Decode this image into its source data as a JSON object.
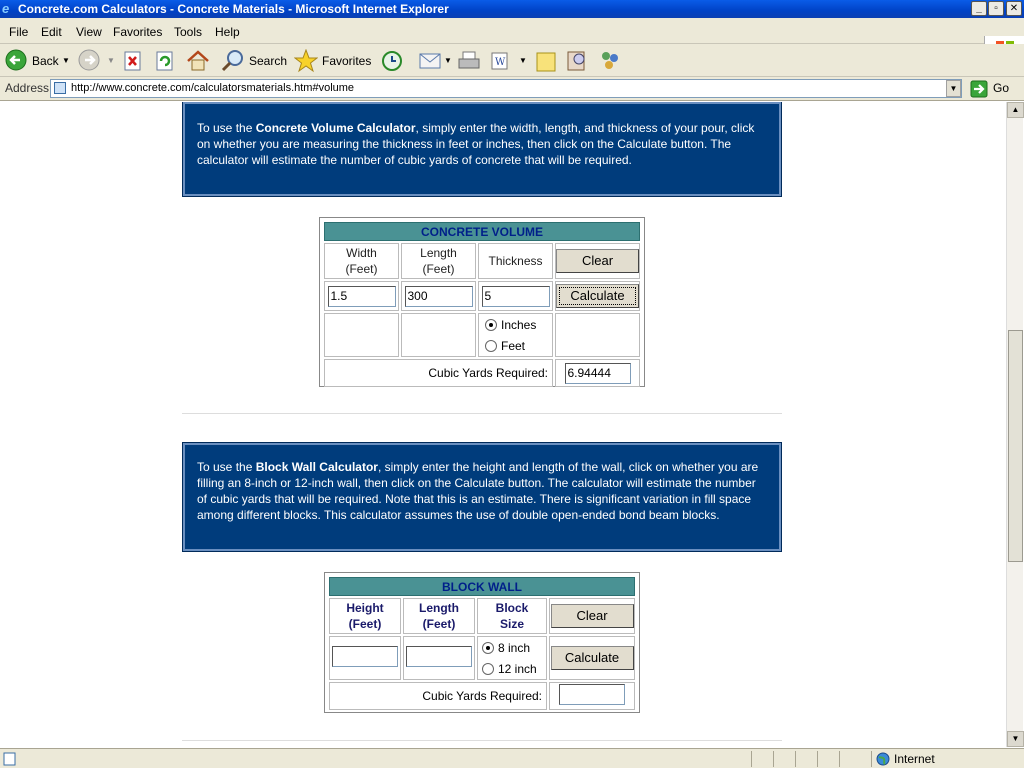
{
  "window": {
    "title": "Concrete.com Calculators - Concrete Materials - Microsoft Internet Explorer",
    "minimize": "_",
    "restore": "▫",
    "close": "✕"
  },
  "menu": [
    "File",
    "Edit",
    "View",
    "Favorites",
    "Tools",
    "Help"
  ],
  "toolbar": {
    "back": "Back",
    "search": "Search",
    "favorites": "Favorites"
  },
  "address": {
    "label": "Address",
    "url": "http://www.concrete.com/calculatorsmaterials.htm#volume",
    "go": "Go"
  },
  "volume": {
    "intro_pre": "To use the ",
    "intro_bold": "Concrete Volume Calculator",
    "intro_post": ", simply enter the width, length, and thickness of your pour, click on whether you are measuring the thickness in feet or inches, then click on the Calculate button. The calculator will estimate the number of cubic yards of concrete that will be required.",
    "header": "CONCRETE VOLUME",
    "width_label_1": "Width",
    "width_label_2": "(Feet)",
    "length_label_1": "Length",
    "length_label_2": "(Feet)",
    "thickness_label": "Thickness",
    "clear": "Clear",
    "calculate": "Calculate",
    "width_value": "1.5",
    "length_value": "300",
    "thickness_value": "5",
    "unit_inches": "Inches",
    "unit_feet": "Feet",
    "result_label": "Cubic Yards Required:",
    "result_value": "6.94444"
  },
  "block": {
    "intro_pre": "To use the ",
    "intro_bold": "Block Wall Calculator",
    "intro_post": ", simply enter the height and length of the wall, click on whether you are filling an 8-inch or 12-inch wall, then click on the Calculate button. The calculator will estimate the number of cubic yards that will be required. Note that this is an estimate. There is significant variation in fill space among different blocks. This calculator assumes the use of double open-ended bond beam blocks.",
    "header": "BLOCK WALL",
    "height_label_1": "Height",
    "height_label_2": "(Feet)",
    "length_label_1": "Length",
    "length_label_2": "(Feet)",
    "size_label_1": "Block",
    "size_label_2": "Size",
    "clear": "Clear",
    "calculate": "Calculate",
    "height_value": "",
    "length_value": "",
    "size_8": "8 inch",
    "size_12": "12 inch",
    "result_label": "Cubic Yards Required:",
    "result_value": ""
  },
  "status": {
    "zone": "Internet"
  }
}
